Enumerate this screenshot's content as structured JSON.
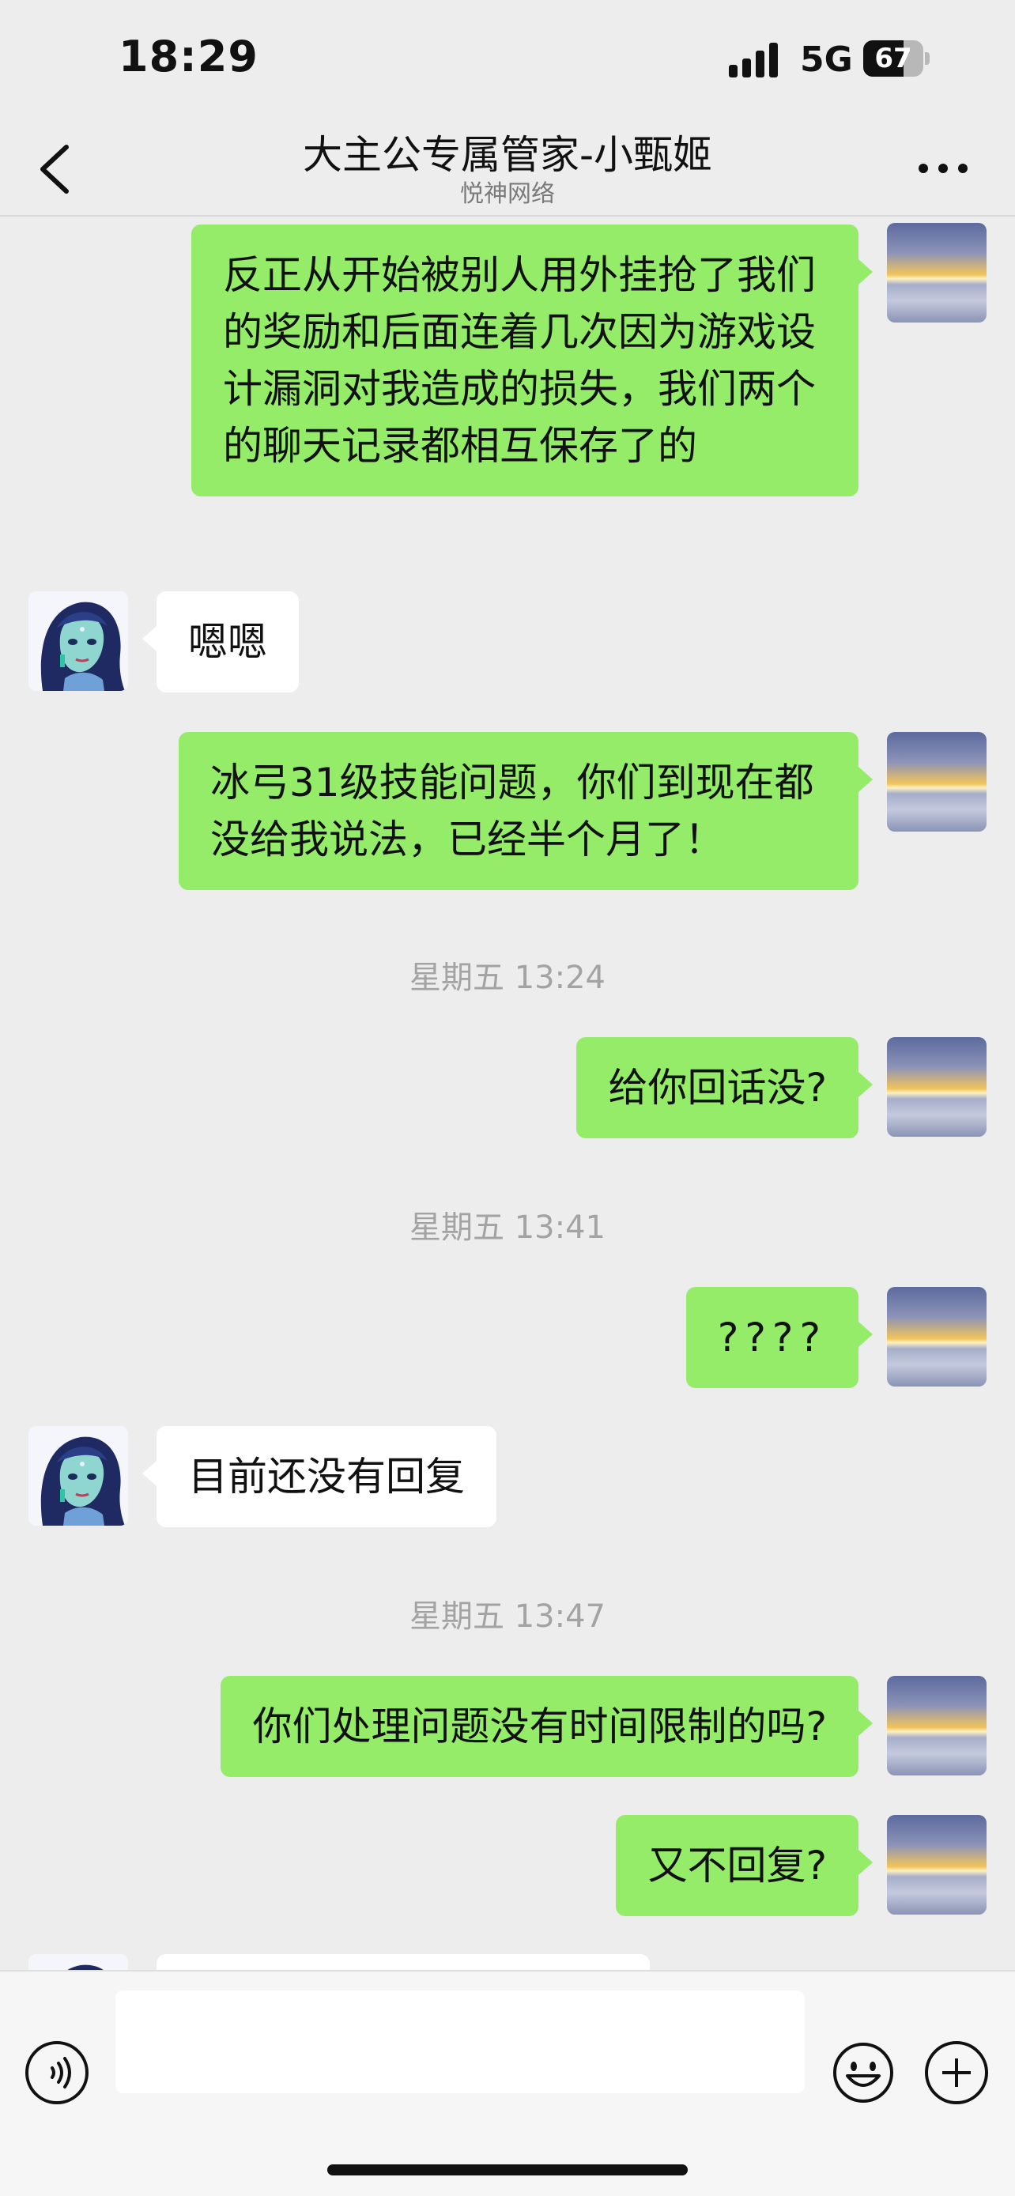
{
  "status_bar": {
    "time": "18:29",
    "network": "5G",
    "battery": "67",
    "battery_level": 0.67
  },
  "header": {
    "title": "大主公专属管家-小甄姬",
    "subtitle": "悦神网络"
  },
  "messages": [
    {
      "type": "sent",
      "text": "反正从开始被别人用外挂抢了我们的奖励和后面连着几次因为游戏设计漏洞对我造成的损失，我们两个的聊天记录都相互保存了的"
    },
    {
      "type": "received",
      "text": "嗯嗯"
    },
    {
      "type": "sent",
      "text": "冰弓31级技能问题，你们到现在都没给我说法，已经半个月了！"
    },
    {
      "type": "time",
      "text": "星期五 13:24"
    },
    {
      "type": "sent",
      "text": "给你回话没?"
    },
    {
      "type": "time",
      "text": "星期五 13:41"
    },
    {
      "type": "sent",
      "text": "????"
    },
    {
      "type": "received",
      "text": "目前还没有回复"
    },
    {
      "type": "time",
      "text": "星期五 13:47"
    },
    {
      "type": "sent",
      "text": "你们处理问题没有时间限制的吗?"
    },
    {
      "type": "sent",
      "text": "又不回复?"
    }
  ],
  "input": {
    "value": "",
    "placeholder": ""
  },
  "icons": {
    "back": "chevron-left-icon",
    "more": "more-dots-icon",
    "voice": "voice-icon",
    "emoji": "emoji-icon",
    "plus": "plus-icon"
  },
  "colors": {
    "sent_bubble": "#95ec69",
    "received_bubble": "#ffffff",
    "background": "#ededed"
  }
}
